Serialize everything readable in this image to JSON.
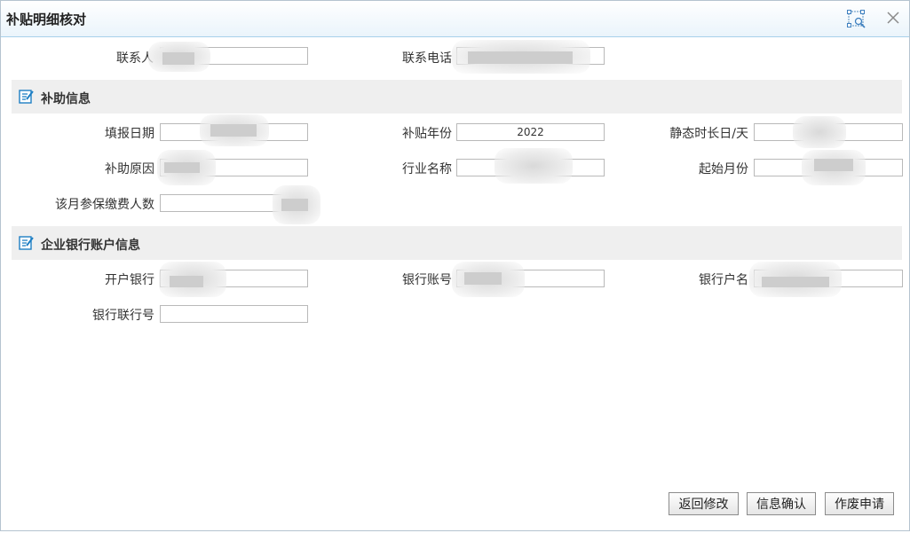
{
  "dialog": {
    "title": "补贴明细核对",
    "icons": {
      "maximize": "fit-window-icon",
      "close": "close-icon"
    }
  },
  "contact": {
    "person_label": "联系人",
    "person_value": "",
    "phone_label": "联系电话",
    "phone_value": ""
  },
  "subsidy_section": {
    "title": "补助信息",
    "icon": "edit-note-icon",
    "fill_date_label": "填报日期",
    "fill_date_value": "",
    "subsidy_year_label": "补贴年份",
    "subsidy_year_value": "2022",
    "static_days_label": "静态时长日/天",
    "static_days_value": "",
    "reason_label": "补助原因",
    "reason_value": "",
    "industry_label": "行业名称",
    "industry_value": "",
    "start_month_label": "起始月份",
    "start_month_value": "",
    "insured_count_label": "该月参保缴费人数",
    "insured_count_value": ""
  },
  "bank_section": {
    "title": "企业银行账户信息",
    "icon": "edit-note-icon",
    "bank_label": "开户银行",
    "bank_value": "",
    "account_no_label": "银行账号",
    "account_no_value": "",
    "account_name_label": "银行户名",
    "account_name_value": "",
    "bank_code_label": "银行联行号",
    "bank_code_value": ""
  },
  "buttons": {
    "back_label": "返回修改",
    "confirm_label": "信息确认",
    "void_label": "作废申请"
  },
  "colors": {
    "titlebar_bottom": "#eaf4fb",
    "titlebar_border": "#a8d0ea",
    "section_bg": "#efefef",
    "icon_blue": "#1e7fc4"
  }
}
